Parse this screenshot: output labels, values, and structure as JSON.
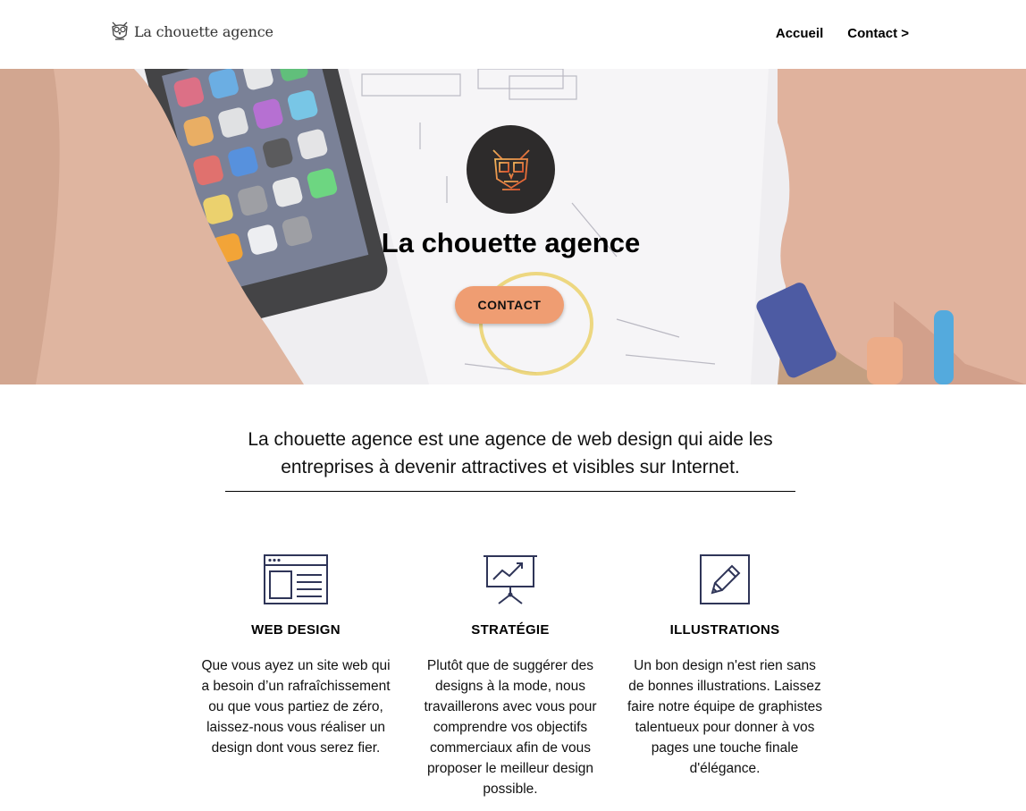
{
  "header": {
    "logo_text": "La chouette agence",
    "nav": [
      {
        "label": "Accueil"
      },
      {
        "label": "Contact >"
      }
    ]
  },
  "hero": {
    "title": "La chouette agence",
    "cta_label": "CONTACT"
  },
  "intro": {
    "text": "La chouette agence est une agence de web design qui aide les entreprises à devenir attractives et visibles sur Internet."
  },
  "services": [
    {
      "icon": "browser-window-icon",
      "title": "WEB DESIGN",
      "text": "Que vous ayez un site web qui a besoin d’un rafraîchissement ou que vous partiez de zéro, laissez-nous vous réaliser un design dont vous serez fier."
    },
    {
      "icon": "presentation-chart-icon",
      "title": "STRATÉGIE",
      "text": "Plutôt que de suggérer des designs à la mode, nous travaillerons avec vous pour comprendre vos objectifs commerciaux afin de vous proposer le meilleur design possible."
    },
    {
      "icon": "pencil-square-icon",
      "title": "ILLUSTRATIONS",
      "text": "Un bon design n'est rien sans de bonnes illustrations. Laissez faire notre équipe de graphistes talentueux pour donner à vos pages une touche finale d'élégance."
    }
  ],
  "colors": {
    "accent": "#ef9d72",
    "icon_stroke": "#2f3558",
    "badge_bg": "#2d2b2b"
  }
}
